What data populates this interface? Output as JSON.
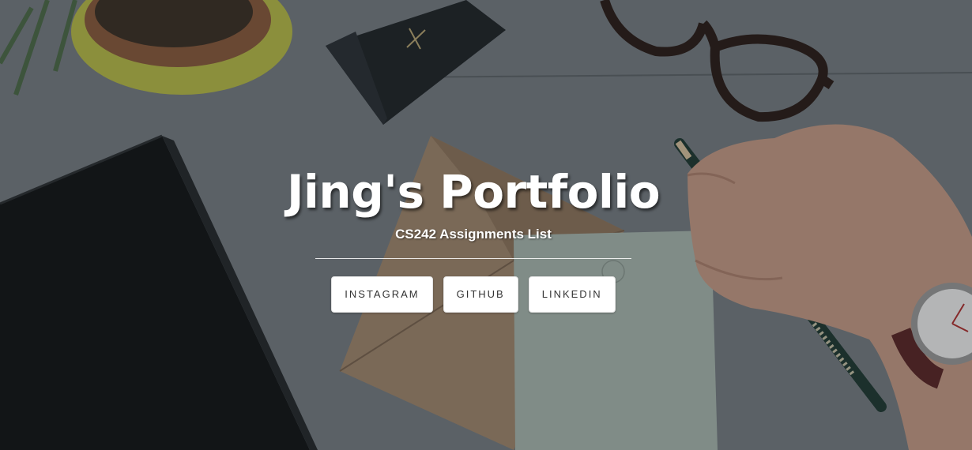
{
  "hero": {
    "title": "Jing's Portfolio",
    "subtitle": "CS242 Assignments List"
  },
  "social": {
    "buttons": [
      {
        "label": "INSTAGRAM",
        "icon": ""
      },
      {
        "label": "GITHUB",
        "icon": ""
      },
      {
        "label": "LINKEDIN",
        "icon": ""
      }
    ]
  },
  "colors": {
    "desk": "#6f767b",
    "overlay": "rgba(20,24,28,0.28)",
    "title_text": "#ffffff",
    "button_bg": "#ffffff",
    "button_text": "#333333"
  }
}
